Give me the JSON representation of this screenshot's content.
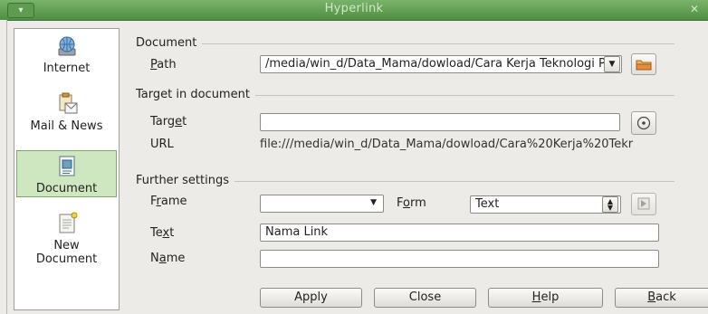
{
  "window": {
    "title": "Hyperlink",
    "menu_glyph": "▾",
    "close_glyph": "✕"
  },
  "sidebar": {
    "items": [
      {
        "label": "Internet",
        "icon": "globe-icon"
      },
      {
        "label": "Mail & News",
        "icon": "mail-news-icon"
      },
      {
        "label": "Document",
        "icon": "document-icon",
        "active": true
      },
      {
        "label": "New Document",
        "icon": "new-document-icon"
      }
    ],
    "new_document_line1": "New",
    "new_document_line2": "Document"
  },
  "document_section": {
    "heading": "Document",
    "path_label_u": "P",
    "path_label_rest": "ath",
    "path_value": "/media/win_d/Data_Mama/dowload/Cara Kerja Teknologi P"
  },
  "target_section": {
    "heading": "Target in document",
    "target_label_pre": "Targ",
    "target_label_u": "e",
    "target_label_post": "t",
    "target_value": "",
    "url_label": "URL",
    "url_value": "file:///media/win_d/Data_Mama/dowload/Cara%20Kerja%20Tekr"
  },
  "further_section": {
    "heading": "Further settings",
    "frame_label_pre": "F",
    "frame_label_u": "r",
    "frame_label_post": "ame",
    "frame_value": "",
    "form_label_pre": "F",
    "form_label_u": "o",
    "form_label_post": "rm",
    "form_value": "Text",
    "text_label_pre": "Te",
    "text_label_u": "x",
    "text_label_post": "t",
    "text_value": "Nama Link",
    "name_label_pre": "N",
    "name_label_u": "a",
    "name_label_post": "me",
    "name_value": ""
  },
  "buttons": {
    "apply": "Apply",
    "close": "Close",
    "help_u": "H",
    "help_rest": "elp",
    "back_u": "B",
    "back_rest": "ack"
  }
}
